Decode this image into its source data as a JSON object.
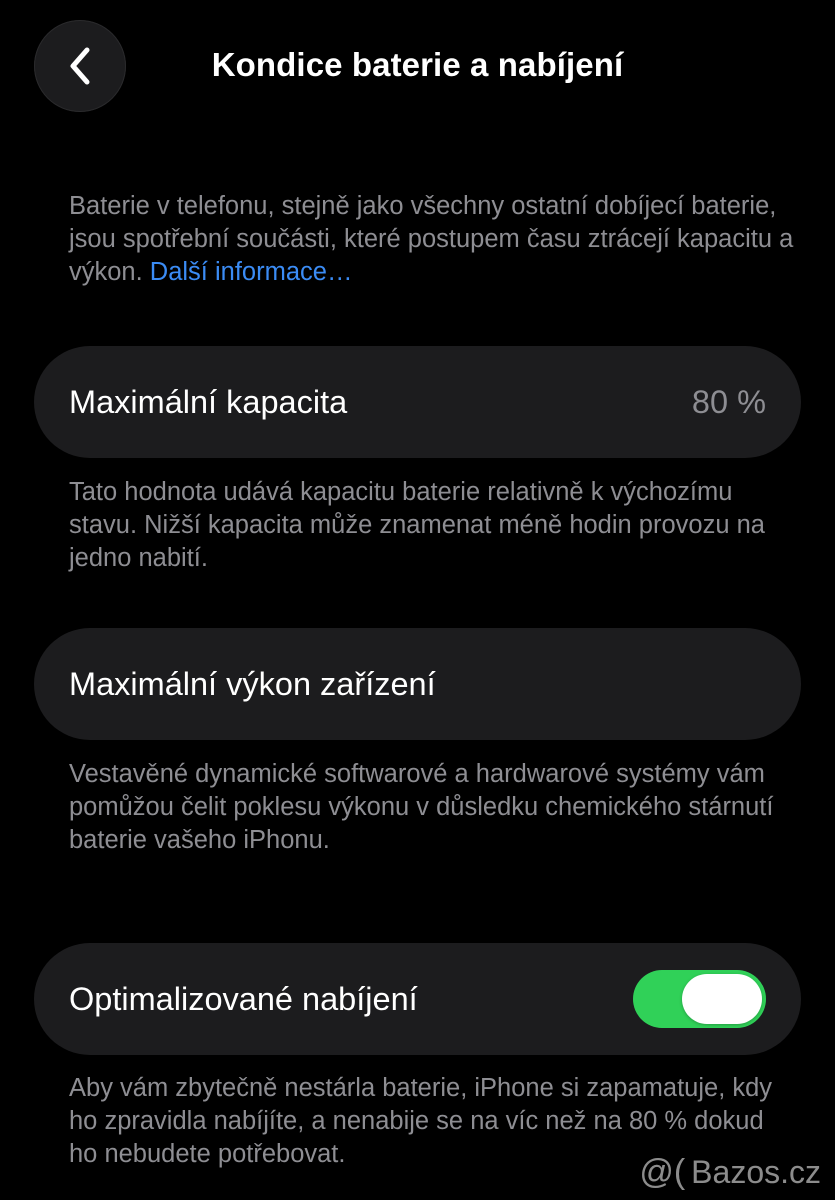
{
  "header": {
    "title": "Kondice baterie a nabíjení",
    "back_icon": "chevron-left-icon"
  },
  "intro": {
    "text": "Baterie v telefonu, stejně jako všechny ostatní dobíjecí baterie, jsou spotřební součásti, které postupem času ztrácejí kapacitu a výkon.",
    "link": "Další informace…"
  },
  "max_capacity": {
    "label": "Maximální kapacita",
    "value": "80 %",
    "description": "Tato hodnota udává kapacitu baterie relativně k výchozímu stavu. Nižší kapacita může znamenat méně hodin provozu na jedno nabití."
  },
  "peak_performance": {
    "label": "Maximální výkon zařízení",
    "description": "Vestavěné dynamické softwarové a hardwarové systémy vám pomůžou čelit poklesu výkonu v důsledku chemického stárnutí baterie vašeho iPhonu."
  },
  "optimized_charging": {
    "label": "Optimalizované nabíjení",
    "enabled": true,
    "toggle_color": "#30d158",
    "description": "Aby vám zbytečně nestárla baterie, iPhone si zapamatuje, kdy ho zpravidla nabíjíte, a nenabije se na víc než na 80 % dokud ho nebudete potřebovat."
  },
  "watermark": {
    "text": "Bazos.cz"
  }
}
